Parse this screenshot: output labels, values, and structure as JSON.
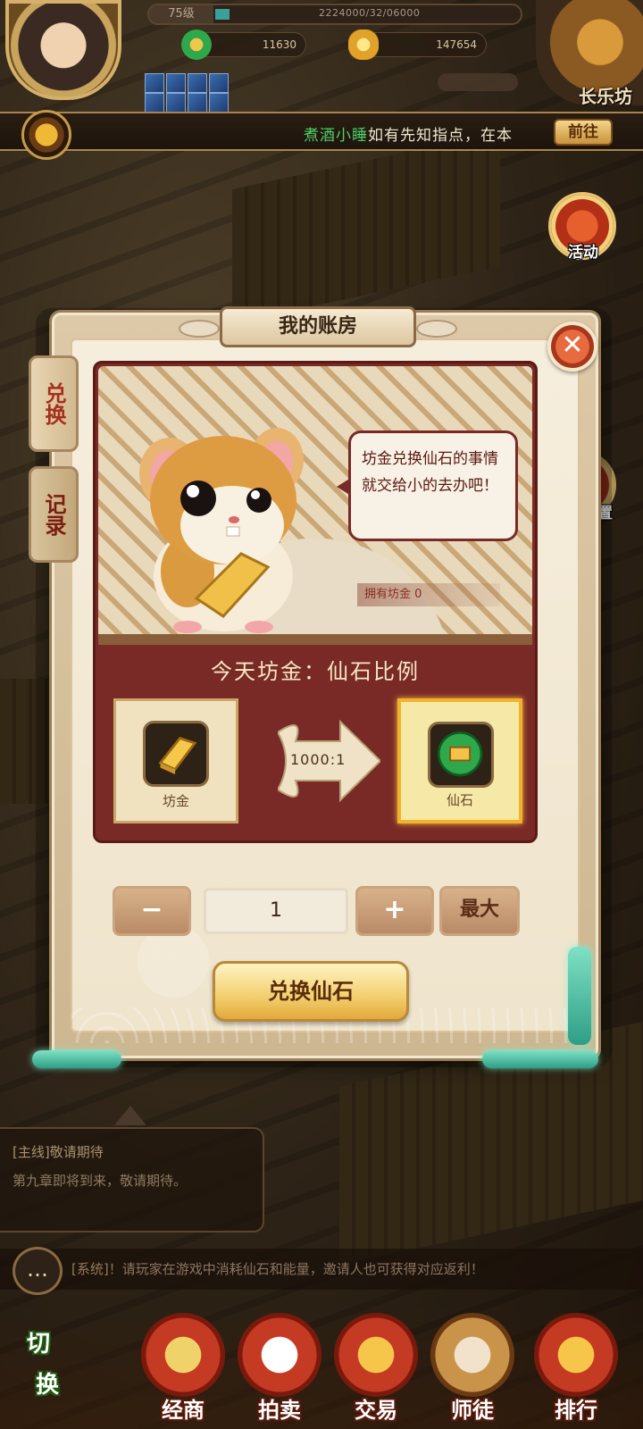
{
  "hud": {
    "level": "75级",
    "exp_text": "2224000/32/06000",
    "jade_amount": "11630",
    "gold_amount": "147654",
    "city_name": "长乐坊"
  },
  "broadcast": {
    "speaker": "煮酒小睡",
    "message": "如有先知指点，在本",
    "goto_label": "前往"
  },
  "side_icons": {
    "activity": "活动",
    "settings": "设置"
  },
  "dialog": {
    "title": "我的账房",
    "tabs": [
      {
        "label": "兑换",
        "active": true
      },
      {
        "label": "记录",
        "active": false
      }
    ],
    "speech": "坊金兑换仙石的事情就交给小的去办吧！",
    "owned_label": "拥有坊金 0",
    "ratio_title": "今天坊金：仙石比例",
    "from_item": {
      "name": "坊金",
      "icon": "gold-bar-icon"
    },
    "to_item": {
      "name": "仙石",
      "icon": "jade-coin-icon"
    },
    "ratio": "1000:1",
    "quantity": {
      "minus_label": "−",
      "value": "1",
      "plus_label": "+",
      "max_label": "最大"
    },
    "exchange_label": "兑换仙石"
  },
  "quest": {
    "title": "[主线]敬请期待",
    "desc": "第九章即将到来，敬请期待。"
  },
  "chat": {
    "tag": "[系统]",
    "message": "！请玩家在游戏中消耗仙石和能量，邀请人也可获得对应返利！"
  },
  "nav": {
    "switch_top": "切",
    "switch_bottom": "换",
    "items": [
      "经商",
      "拍卖",
      "交易",
      "师徒",
      "排行"
    ]
  }
}
